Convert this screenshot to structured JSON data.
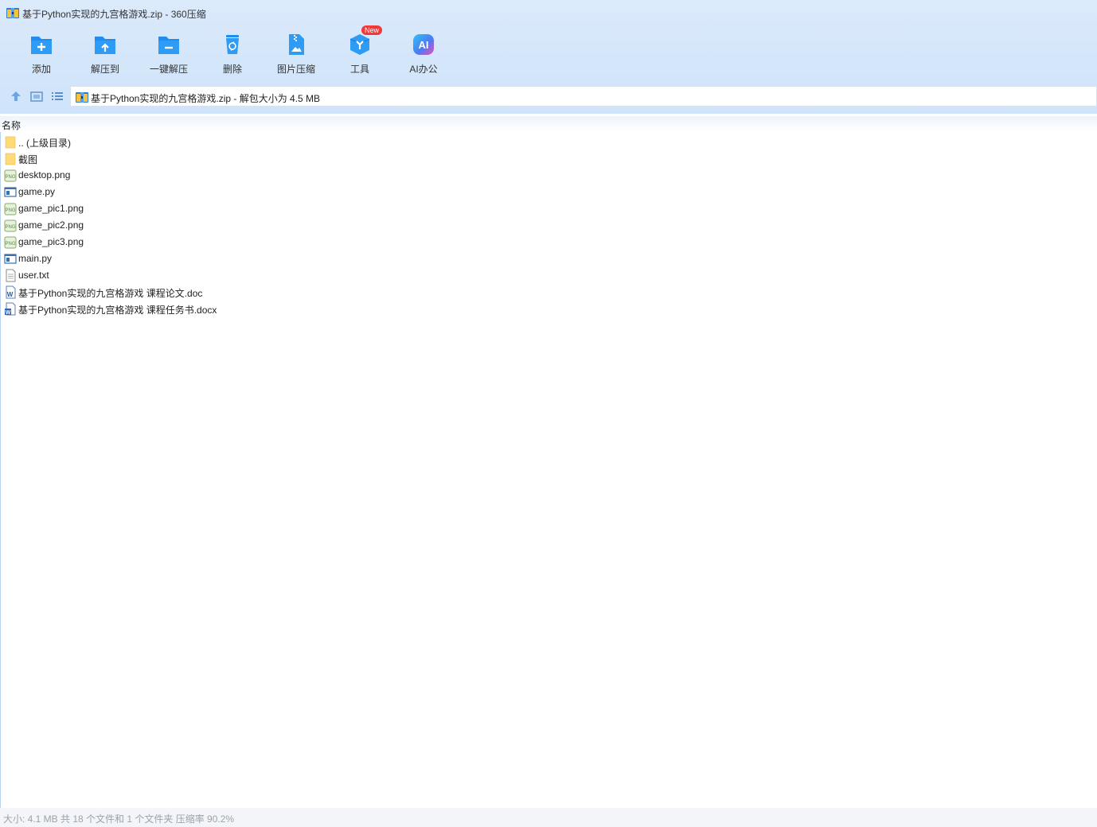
{
  "window": {
    "title": "基于Python实现的九宫格游戏.zip - 360压缩"
  },
  "toolbar": {
    "items": [
      {
        "label": "添加",
        "icon": "add-folder-icon"
      },
      {
        "label": "解压到",
        "icon": "extract-to-icon"
      },
      {
        "label": "一键解压",
        "icon": "one-click-extract-icon"
      },
      {
        "label": "删除",
        "icon": "recycle-bin-icon"
      },
      {
        "label": "图片压缩",
        "icon": "image-compress-icon"
      },
      {
        "label": "工具",
        "icon": "tools-cube-icon",
        "badge": "New"
      },
      {
        "label": "AI办公",
        "icon": "ai-office-icon"
      }
    ]
  },
  "nav": {
    "address": "基于Python实现的九宫格游戏.zip - 解包大小为 4.5 MB",
    "buttons": [
      "up-arrow-icon",
      "thumbnail-view-icon",
      "list-view-icon"
    ]
  },
  "list": {
    "header_name": "名称",
    "files": [
      {
        "name": ".. (上级目录)",
        "type": "folder"
      },
      {
        "name": "截图",
        "type": "folder"
      },
      {
        "name": "desktop.png",
        "type": "png"
      },
      {
        "name": "game.py",
        "type": "py"
      },
      {
        "name": "game_pic1.png",
        "type": "png"
      },
      {
        "name": "game_pic2.png",
        "type": "png"
      },
      {
        "name": "game_pic3.png",
        "type": "png"
      },
      {
        "name": "main.py",
        "type": "py"
      },
      {
        "name": "user.txt",
        "type": "txt"
      },
      {
        "name": "基于Python实现的九宫格游戏 课程论文.doc",
        "type": "doc"
      },
      {
        "name": "基于Python实现的九宫格游戏 课程任务书.docx",
        "type": "docx"
      }
    ]
  },
  "status": {
    "text": "大小: 4.1 MB 共 18 个文件和 1 个文件夹 压缩率 90.2%"
  },
  "colors": {
    "accent": "#1e8cf0",
    "header_bg": "#d2e5fa",
    "badge": "#f03a3a"
  }
}
